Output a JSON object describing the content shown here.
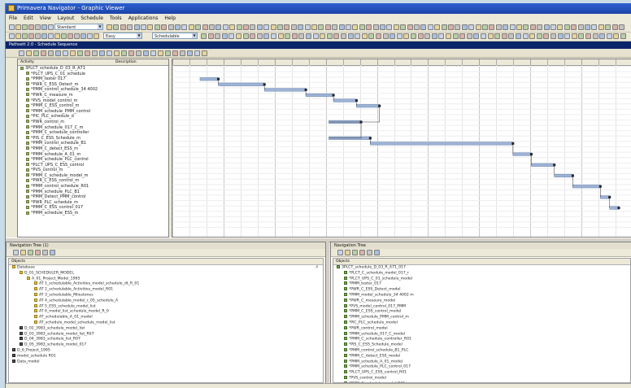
{
  "window": {
    "title": "Primavera Navigator - Graphic Viewer"
  },
  "menu": [
    "File",
    "Edit",
    "View",
    "Layout",
    "Schedule",
    "Tools",
    "Applications",
    "Help"
  ],
  "toolbars": {
    "row1_combo": "Standard",
    "row2_combo_a": "Easy",
    "row2_combo_b": "Schedulable"
  },
  "document": {
    "title": "Pathsett 2.0 - Schedule Sequence"
  },
  "activity_tree": {
    "header": [
      "Activity",
      "Description"
    ],
    "rows": [
      "3PLCT_schedule_D_03_R_A71",
      "*PLCT_UPS_C_01_schedule",
      "*PMM_tester 017",
      "*PWR_C_ESS_Detect_m",
      "*PMM_control_schedule_34 4002",
      "*PWR_C_measure_m",
      "*PVS_model_control_m",
      "*PMM_C_ESS_control_m",
      "*PMM_schedule_PMM_control",
      "*PIC_PLC_schedule_d",
      "*PWR_control_m",
      "*PMM_schedule_017_C_m",
      "*PMM_C_schedule_controller",
      "*PIS_C_ESS_Schedule_m",
      "*PMM_control_schedule_B1",
      "*PMM_C_detect_ESS_m",
      "*PMM_schedule_A_01_m",
      "*PMM_schedule_PLC_control",
      "*PLCT_UPS_C_ESS_control",
      "*PVS_control_m",
      "*PMM_C_schedule_model_m",
      "*PWR_C_ESS_control_m",
      "*PMM_control_schedule_R01",
      "*PMM_schedule_PLC_B1",
      "*PMM_Detect_PMM_control",
      "*PWR_PLC_schedule_m",
      "*PMM_C_ESS_control_017",
      "*PMM_schedule_ESS_m"
    ]
  },
  "gantt": {
    "bars": [
      {
        "start": 0.06,
        "end": 0.1,
        "row": 2
      },
      {
        "start": 0.1,
        "end": 0.2,
        "row": 3
      },
      {
        "start": 0.2,
        "end": 0.29,
        "row": 4
      },
      {
        "start": 0.29,
        "end": 0.35,
        "row": 5
      },
      {
        "start": 0.35,
        "end": 0.4,
        "row": 6
      },
      {
        "start": 0.4,
        "end": 0.45,
        "row": 7
      },
      {
        "start": 0.34,
        "end": 0.41,
        "row": 10
      },
      {
        "start": 0.34,
        "end": 0.43,
        "row": 13
      },
      {
        "start": 0.43,
        "end": 0.74,
        "row": 14
      },
      {
        "start": 0.74,
        "end": 0.78,
        "row": 16
      },
      {
        "start": 0.78,
        "end": 0.83,
        "row": 18
      },
      {
        "start": 0.83,
        "end": 0.87,
        "row": 20
      },
      {
        "start": 0.87,
        "end": 0.93,
        "row": 22
      },
      {
        "start": 0.93,
        "end": 0.95,
        "row": 24
      },
      {
        "start": 0.95,
        "end": 0.97,
        "row": 26
      }
    ]
  },
  "panel_left": {
    "title": "Navigation Tree (1)",
    "header": "Objects",
    "rows": [
      {
        "text": "Database",
        "level": 0,
        "icon": "folder"
      },
      {
        "text": "D_01_SCHEDULER_MODEL",
        "level": 1,
        "icon": "folder"
      },
      {
        "text": "A_01_Project_Model_1995",
        "level": 2,
        "icon": "folder"
      },
      {
        "text": "AT 1_schedulable_Activities_model_schedule_dt_R_01",
        "level": 3,
        "icon": "folder"
      },
      {
        "text": "AT 2_schedulable_Activities_model_R01",
        "level": 3,
        "icon": "folder"
      },
      {
        "text": "AT 3_schedulable_Milestones",
        "level": 3,
        "icon": "folder"
      },
      {
        "text": "AT 4_schedulable_model_r_05_schedule_A",
        "level": 3,
        "icon": "folder"
      },
      {
        "text": "AT 5_ESS_schedule_model_list",
        "level": 3,
        "icon": "folder"
      },
      {
        "text": "AT 6_model_list_schedule_model_R_0",
        "level": 3,
        "icon": "folder"
      },
      {
        "text": "AT_schedulable_A_01_model",
        "level": 3,
        "icon": "folder"
      },
      {
        "text": "AT_schedule_model_schedule_model_list",
        "level": 3,
        "icon": "folder"
      },
      {
        "text": "D_02_3983_schedule_model_list",
        "level": 1,
        "icon": "dark"
      },
      {
        "text": "D_03_3983_schedule_model_list_R07",
        "level": 1,
        "icon": "dark"
      },
      {
        "text": "D_04_3983_schedule_list_R07",
        "level": 1,
        "icon": "dark"
      },
      {
        "text": "D_05_3983_schedule_model_017",
        "level": 1,
        "icon": "dark"
      },
      {
        "text": "D_6_Project_1995",
        "level": 0,
        "icon": "dark"
      },
      {
        "text": "model_schedule R01",
        "level": 0,
        "icon": "dark"
      },
      {
        "text": "Data_model",
        "level": 0,
        "icon": "dark"
      }
    ]
  },
  "panel_right": {
    "title": "Navigation Tree",
    "header": "Objects",
    "rows": [
      {
        "text": "3PLCT_schedule_D_03_R_A71_017",
        "level": 0,
        "icon": "green"
      },
      {
        "text": "*PLCT_C_schedule_model_017_r",
        "level": 1,
        "icon": "green"
      },
      {
        "text": "*PLCT_UPS_C_01_schedule_model",
        "level": 1,
        "icon": "green"
      },
      {
        "text": "*PMM_tester_017",
        "level": 1,
        "icon": "green"
      },
      {
        "text": "*PWR_C_ESS_Detect_model",
        "level": 1,
        "icon": "green"
      },
      {
        "text": "*PMM_model_schedule_34 4002 m",
        "level": 1,
        "icon": "green"
      },
      {
        "text": "*PWR_C_measure_model",
        "level": 1,
        "icon": "green"
      },
      {
        "text": "*PVS_model_control_017_PMM",
        "level": 1,
        "icon": "green"
      },
      {
        "text": "*PMM_C_ESS_control_model",
        "level": 1,
        "icon": "green"
      },
      {
        "text": "*PMM_schedule_PMM_control_m",
        "level": 1,
        "icon": "green"
      },
      {
        "text": "*PIC_PLC_schedule_model",
        "level": 1,
        "icon": "green"
      },
      {
        "text": "*PWR_control_model",
        "level": 1,
        "icon": "green"
      },
      {
        "text": "*PMM_schedule_017_C_model",
        "level": 1,
        "icon": "green"
      },
      {
        "text": "*PMM_C_schedule_controller_R01",
        "level": 1,
        "icon": "green"
      },
      {
        "text": "*PIS_C_ESS_Schedule_model",
        "level": 1,
        "icon": "green"
      },
      {
        "text": "*PMM_control_schedule_B1_PLC",
        "level": 1,
        "icon": "green"
      },
      {
        "text": "*PMM_C_detect_ESS_model",
        "level": 1,
        "icon": "green"
      },
      {
        "text": "*PMM_schedule_A_01_model",
        "level": 1,
        "icon": "green"
      },
      {
        "text": "*PMM_schedule_PLC_control_017",
        "level": 1,
        "icon": "green"
      },
      {
        "text": "*PLCT_UPS_C_ESS_control_R01",
        "level": 1,
        "icon": "green"
      },
      {
        "text": "*PVS_control_model",
        "level": 1,
        "icon": "green"
      },
      {
        "text": "*PMM_C_schedule_model_R01",
        "level": 1,
        "icon": "green"
      },
      {
        "text": "*PWR_C_ESS_control_model",
        "level": 1,
        "icon": "green"
      }
    ]
  }
}
